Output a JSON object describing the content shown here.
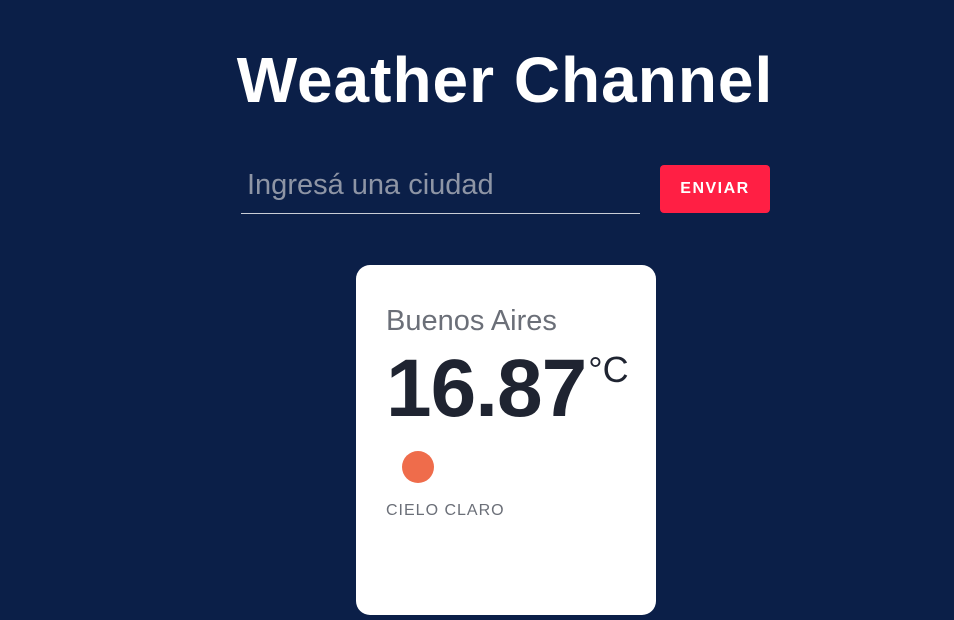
{
  "header": {
    "title": "Weather Channel"
  },
  "search": {
    "placeholder": "Ingresá una ciudad",
    "value": "",
    "submit_label": "ENVIAR"
  },
  "weather": {
    "city": "Buenos Aires",
    "temperature": "16.87",
    "unit": "°C",
    "icon": "sun-icon",
    "description": "CIELO CLARO"
  },
  "colors": {
    "background": "#0b1f48",
    "accent": "#ff1f44",
    "card": "#ffffff",
    "sun": "#ef6c4b"
  }
}
